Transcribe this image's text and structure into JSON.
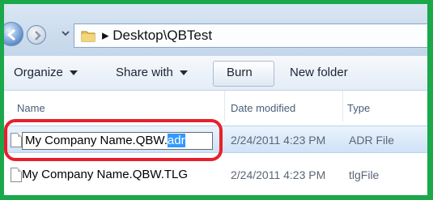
{
  "window": {
    "breadcrumb": "▸ Desktop\\QBTest"
  },
  "toolbar": {
    "organize": "Organize",
    "share_with": "Share with",
    "burn": "Burn",
    "new_folder": "New folder"
  },
  "columns": {
    "name": "Name",
    "date_modified": "Date modified",
    "type": "Type"
  },
  "files": [
    {
      "name_base": "My Company Name.QBW.",
      "name_ext": "adr",
      "date": "2/24/2011 4:23 PM",
      "type": "ADR File",
      "state": "renaming",
      "selected_text": "adr"
    },
    {
      "name": "My Company Name.QBW.TLG",
      "date": "2/24/2011 4:23 PM",
      "type": "tlgFile"
    }
  ],
  "colors": {
    "frame_border": "#1ba84a",
    "callout": "#e8202a",
    "selection": "#3399ff",
    "row_selected": "#cfe2f7"
  }
}
